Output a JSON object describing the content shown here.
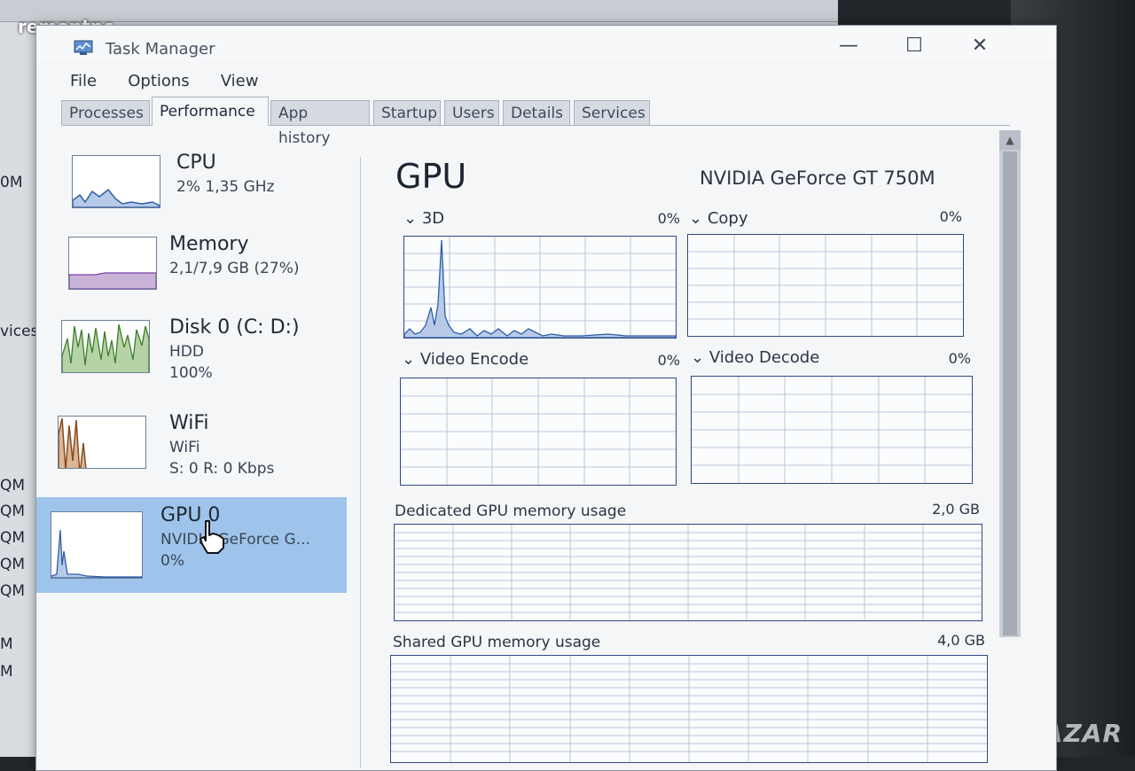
{
  "background": {
    "logo_text": "remontpc",
    "watermark_text": "BAZAR",
    "fragments": [
      "0M",
      "vices",
      "QM",
      "QM",
      "QM",
      "QM",
      "QM",
      "M",
      "M"
    ]
  },
  "window": {
    "title": "Task Manager",
    "buttons": {
      "minimize": "—",
      "maximize": "☐",
      "close": "✕"
    }
  },
  "menu": [
    "File",
    "Options",
    "View"
  ],
  "tabs": [
    "Processes",
    "Performance",
    "App history",
    "Startup",
    "Users",
    "Details",
    "Services"
  ],
  "active_tab": "Performance",
  "resources": [
    {
      "name": "CPU",
      "line1": "2%  1,35 GHz",
      "line2": "",
      "graph_color": "#2f5ea8",
      "graph_fill": "#b7cbe8"
    },
    {
      "name": "Memory",
      "line1": "2,1/7,9 GB (27%)",
      "line2": "",
      "graph_color": "#7b3fa0",
      "graph_fill": "#c9b4d8"
    },
    {
      "name": "Disk 0 (C: D:)",
      "line1": "HDD",
      "line2": "100%",
      "graph_color": "#3b7d2a",
      "graph_fill": "#b6d3a7"
    },
    {
      "name": "WiFi",
      "line1": "WiFi",
      "line2": "S: 0 R: 0 Kbps",
      "graph_color": "#8a4a18",
      "graph_fill": "#d9b799"
    },
    {
      "name": "GPU 0",
      "line1": "NVIDIA GeForce G...",
      "line2": "0%",
      "graph_color": "#2f5ea8",
      "graph_fill": "#b7cbe8"
    }
  ],
  "selected_resource": "GPU 0",
  "detail": {
    "title": "GPU",
    "model": "NVIDIA GeForce GT 750M",
    "engines": [
      {
        "label": "3D",
        "pct": "0%"
      },
      {
        "label": "Copy",
        "pct": "0%"
      },
      {
        "label": "Video Encode",
        "pct": "0%"
      },
      {
        "label": "Video Decode",
        "pct": "0%"
      }
    ],
    "dedicated_memory": {
      "label": "Dedicated GPU memory usage",
      "value": "2,0 GB"
    },
    "shared_memory": {
      "label": "Shared GPU memory usage",
      "value": "4,0 GB"
    }
  }
}
